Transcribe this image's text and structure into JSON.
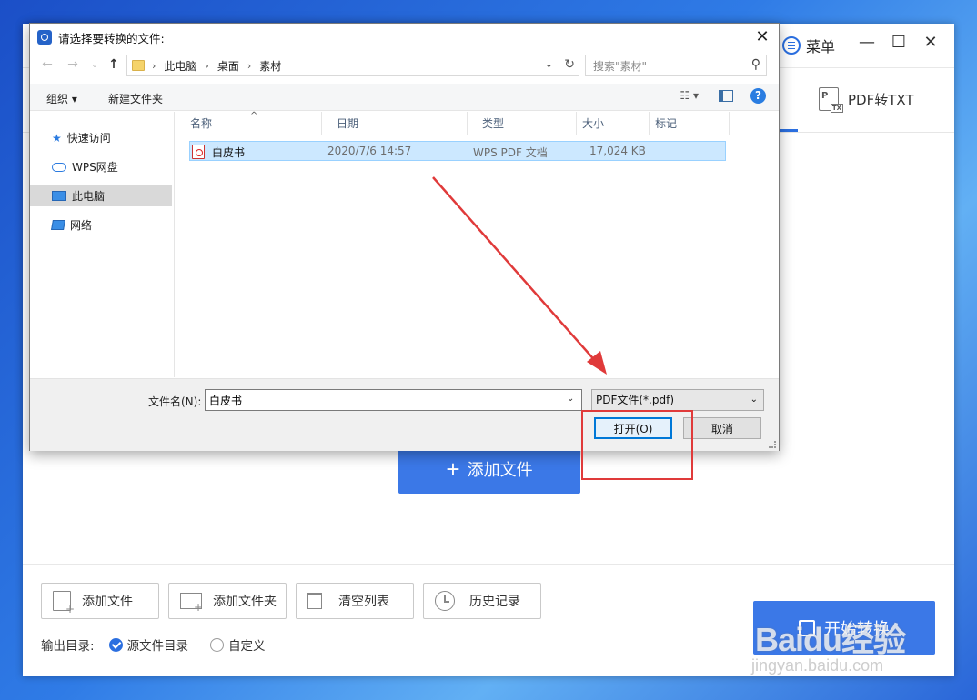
{
  "app": {
    "menu_label": "菜单",
    "tab_label": "PDF转TXT",
    "add_file_big_label": "添加文件",
    "footer": {
      "add_file": "添加文件",
      "add_folder": "添加文件夹",
      "clear_list": "清空列表",
      "history": "历史记录",
      "output_label": "输出目录:",
      "opt_source": "源文件目录",
      "opt_custom": "自定义",
      "start_label": "开始转换"
    }
  },
  "dialog": {
    "title": "请选择要转换的文件:",
    "breadcrumb": [
      "此电脑",
      "桌面",
      "素材"
    ],
    "search_placeholder": "搜索\"素材\"",
    "toolbar": {
      "organize": "组织 ▾",
      "new_folder": "新建文件夹"
    },
    "nav": [
      "快速访问",
      "WPS网盘",
      "此电脑",
      "网络"
    ],
    "columns": [
      "名称",
      "日期",
      "类型",
      "大小",
      "标记"
    ],
    "files": [
      {
        "name": "白皮书",
        "date": "2020/7/6 14:57",
        "type": "WPS PDF 文档",
        "size": "17,024 KB",
        "tag": ""
      }
    ],
    "filename_label": "文件名(N):",
    "filename_value": "白皮书",
    "filetype_value": "PDF文件(*.pdf)",
    "open_button": "打开(O)",
    "cancel_button": "取消"
  },
  "watermark": {
    "text": "Baidu经验",
    "sub": "jingyan.baidu.com"
  },
  "colors": {
    "accent": "#3b78e7",
    "annotation": "#e03a3a",
    "selection": "#cce8ff"
  }
}
